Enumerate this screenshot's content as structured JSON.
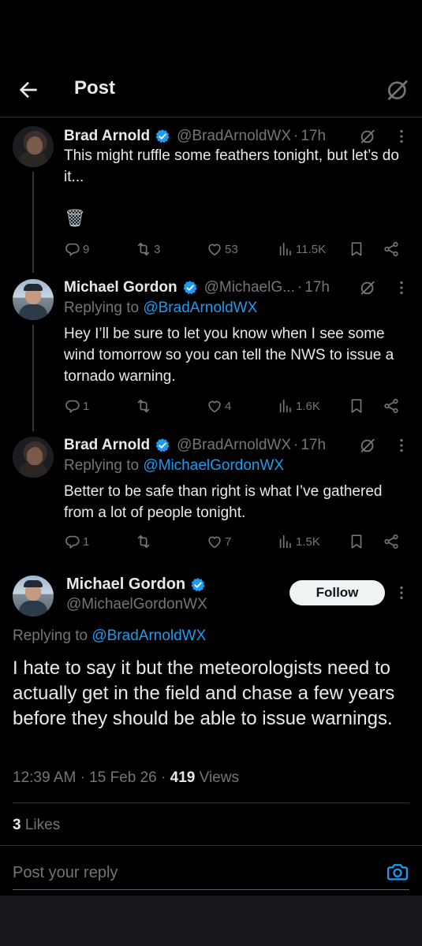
{
  "header": {
    "title": "Post"
  },
  "thread": [
    {
      "name": "Brad Arnold",
      "handle": "@BradArnoldWX",
      "time": "17h",
      "replying_prefix": "",
      "replying_to": "",
      "text": "This might ruffle some feathers tonight, but let’s do it...",
      "emoji": "🗑",
      "replies": "9",
      "reposts": "3",
      "likes": "53",
      "views": "11.5K"
    },
    {
      "name": "Michael Gordon",
      "handle": "@MichaelG...",
      "time": "17h",
      "replying_prefix": "Replying to ",
      "replying_to": "@BradArnoldWX",
      "text": "Hey I’ll be sure to let you know when I see some wind tomorrow so you can tell the NWS to issue a tornado warning.",
      "replies": "1",
      "reposts": "",
      "likes": "4",
      "views": "1.6K"
    },
    {
      "name": "Brad Arnold",
      "handle": "@BradArnoldWX",
      "time": "17h",
      "replying_prefix": "Replying to ",
      "replying_to": "@MichaelGordonWX",
      "text": "Better to be safe than right is what I’ve gathered from a lot of people tonight.",
      "replies": "1",
      "reposts": "",
      "likes": "7",
      "views": "1.5K"
    }
  ],
  "main_post": {
    "name": "Michael Gordon",
    "handle": "@MichaelGordonWX",
    "follow_label": "Follow",
    "replying_prefix": "Replying to ",
    "replying_to": "@BradArnoldWX",
    "text": "I hate to say it but the meteorologists need to actually get in the field and chase a few years before they should be able to issue warnings.",
    "time": "12:39 AM",
    "date": "15 Feb 26",
    "views_count": "419",
    "views_label": "Views",
    "likes_count": "3",
    "likes_label": "Likes"
  },
  "reply_box": {
    "placeholder": "Post your reply"
  },
  "colors": {
    "background": "#000000",
    "link": "#1d9bf0",
    "muted": "#71767b",
    "verified": "#1d9bf0"
  }
}
